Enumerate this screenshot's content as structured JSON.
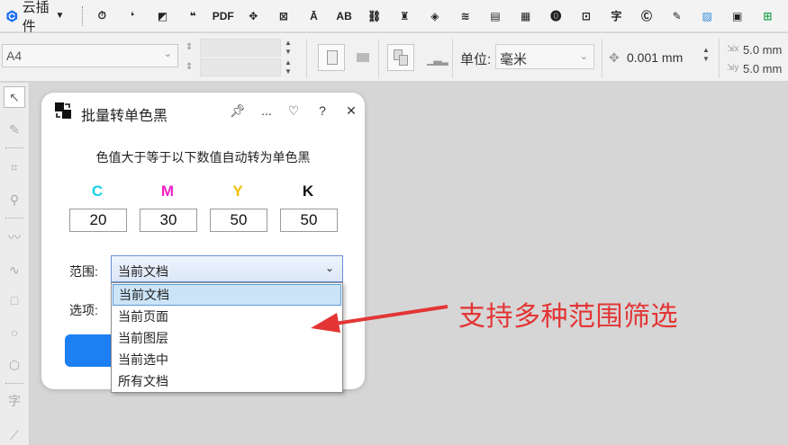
{
  "plugin_bar": {
    "brand_label": "云插件",
    "tool_icons": [
      {
        "name": "timer-clock-icon",
        "glyph": "⏱"
      },
      {
        "name": "quote-single-icon",
        "glyph": "❛"
      },
      {
        "name": "batch-mono-icon",
        "glyph": "◩"
      },
      {
        "name": "quote-double-icon",
        "glyph": "❝"
      },
      {
        "name": "pdf-icon",
        "glyph": "PDF"
      },
      {
        "name": "node-path-icon",
        "glyph": "✥"
      },
      {
        "name": "crop-mark-icon",
        "glyph": "⊠"
      },
      {
        "name": "text-align-icon",
        "glyph": "Ā"
      },
      {
        "name": "ab-text-icon",
        "glyph": "AB"
      },
      {
        "name": "link-tag-icon",
        "glyph": "⛓"
      },
      {
        "name": "figure-icon",
        "glyph": "♜"
      },
      {
        "name": "layers-3d-icon",
        "glyph": "◈"
      },
      {
        "name": "wave-lines-icon",
        "glyph": "≋"
      },
      {
        "name": "document-copy-icon",
        "glyph": "▤"
      },
      {
        "name": "grid-layout-icon",
        "glyph": "▦"
      },
      {
        "name": "number-badge-icon",
        "glyph": "⓿"
      },
      {
        "name": "image-text-icon",
        "glyph": "⊡"
      },
      {
        "name": "font-convert-icon",
        "glyph": "字"
      },
      {
        "name": "copyright-c-icon",
        "glyph": "Ⓒ"
      },
      {
        "name": "image-edit-icon",
        "glyph": "✎"
      },
      {
        "name": "picture-icon",
        "glyph": "▨"
      },
      {
        "name": "film-image-icon",
        "glyph": "▣"
      },
      {
        "name": "green-grid-icon",
        "glyph": "⊞"
      }
    ]
  },
  "prop_bar": {
    "page_size": "A4",
    "unit_label": "单位:",
    "unit_value": "毫米",
    "nudge_value": "0.001 mm",
    "dup_x": "5.0 mm",
    "dup_y": "5.0 mm"
  },
  "dialog": {
    "title": "批量转单色黑",
    "header_more": "...",
    "header_help": "?",
    "header_close": "✕",
    "description": "色值大于等于以下数值自动转为单色黑",
    "channels": [
      {
        "label": "C",
        "value": "20",
        "color": "#19d0e8"
      },
      {
        "label": "M",
        "value": "30",
        "color": "#f020c8"
      },
      {
        "label": "Y",
        "value": "50",
        "color": "#f0c000"
      },
      {
        "label": "K",
        "value": "50",
        "color": "#111111"
      }
    ],
    "range_label": "范围:",
    "range_value": "当前文档",
    "options_label": "选项:"
  },
  "dropdown": {
    "options": [
      "当前文档",
      "当前页面",
      "当前图层",
      "当前选中",
      "所有文档"
    ],
    "selected": "当前文档"
  },
  "annotation": {
    "text": "支持多种范围筛选",
    "color": "#e33535"
  },
  "colors": {
    "accent": "#1c7ff2",
    "select_border": "#6a8fd3",
    "dropdown_highlight": "#cce4f7"
  }
}
